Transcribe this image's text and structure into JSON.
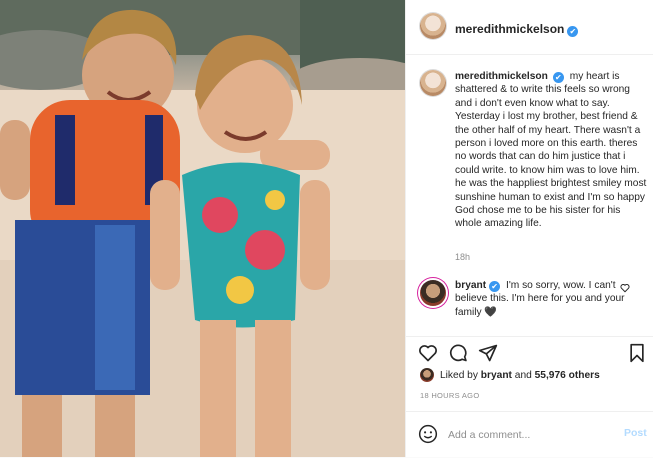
{
  "post": {
    "author": "meredithmickelson",
    "caption": "my heart is shattered & to write this feels so wrong and i don't even know what to say. Yesterday i lost my brother, best friend & the other half of my heart. There wasn't a person i loved more on this earth. theres no words that can do him justice that i could write. to know him was to love him. he was the happliest brightest smiley most sunshine human to exist and I'm so happy God chose me to be his sister for his whole amazing life.",
    "caption_age": "18h",
    "likes_text_prefix": "Liked by",
    "likes_user": "bryant",
    "likes_and": "and",
    "likes_count": "55,976 others",
    "timestamp": "18 HOURS AGO"
  },
  "comment": {
    "author": "bryant",
    "text": "I'm so sorry, wow. I can't believe this. I'm here for you and your family 🖤"
  },
  "composer": {
    "placeholder": "Add a comment...",
    "post_label": "Post"
  },
  "icons": [
    "verified-badge-icon",
    "heart-icon",
    "comment-icon",
    "share-icon",
    "bookmark-icon",
    "emoji-icon"
  ],
  "colors": {
    "verified": "#3897f0",
    "post_disabled": "#b3dbff",
    "meta": "#8e8e8e"
  }
}
